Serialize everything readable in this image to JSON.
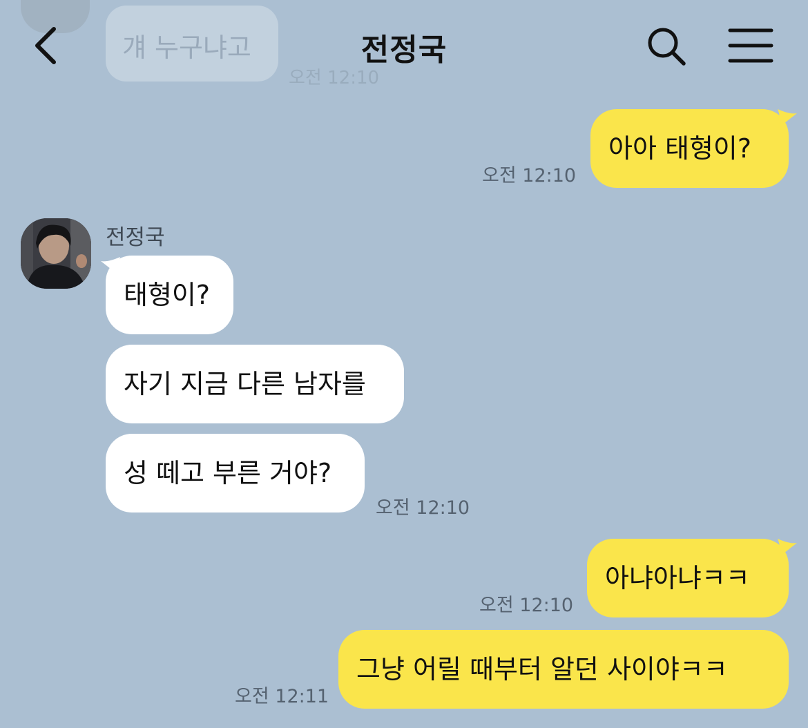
{
  "header": {
    "title": "전정국",
    "back_icon": "chevron-left-icon",
    "search_icon": "search-icon",
    "menu_icon": "hamburger-menu-icon"
  },
  "faded_previous": {
    "text": "걔 누구냐고",
    "time": "오전 12:10"
  },
  "contact": {
    "name": "전정국"
  },
  "messages": [
    {
      "side": "mine",
      "text": "아아 태형이?",
      "time": "오전 12:10"
    },
    {
      "side": "theirs",
      "text": "태형이?"
    },
    {
      "side": "theirs",
      "text": "자기 지금 다른 남자를"
    },
    {
      "side": "theirs",
      "text": "성 떼고 부른 거야?",
      "time": "오전 12:10"
    },
    {
      "side": "mine",
      "text": "아냐아냐ㅋㅋ",
      "time": "오전 12:10"
    },
    {
      "side": "mine",
      "text": "그냥 어릴 때부터 알던 사이야ㅋㅋ",
      "time": "오전 12:11"
    }
  ],
  "colors": {
    "background": "#abbfd2",
    "my_bubble": "#fae54b",
    "their_bubble": "#ffffff",
    "timestamp": "#556270"
  }
}
